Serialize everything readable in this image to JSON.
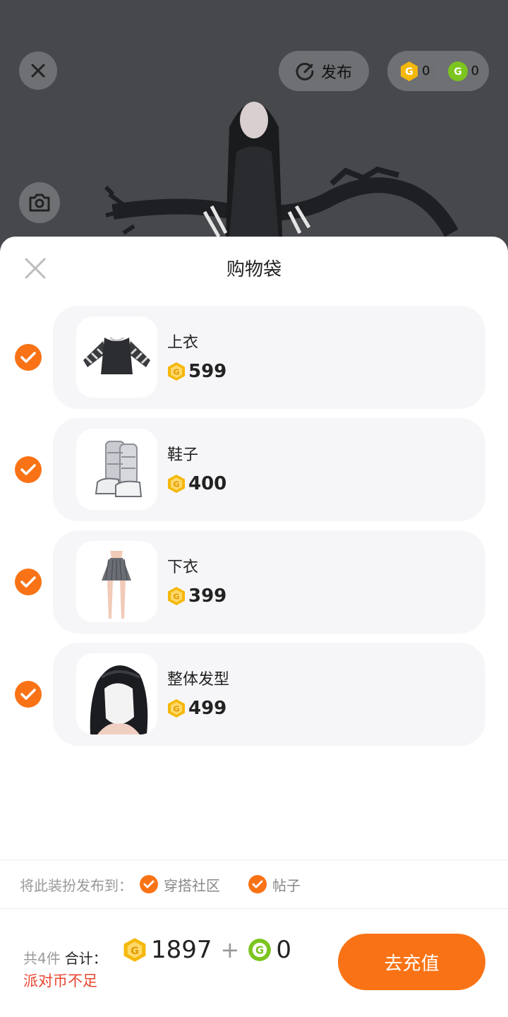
{
  "top_bar": {
    "publish_label": "发布",
    "gold_balance": "0",
    "green_balance": "0"
  },
  "sheet": {
    "title": "购物袋",
    "items": [
      {
        "name": "上衣",
        "price": "599",
        "checked": true
      },
      {
        "name": "鞋子",
        "price": "400",
        "checked": true
      },
      {
        "name": "下衣",
        "price": "399",
        "checked": true
      },
      {
        "name": "整体发型",
        "price": "499",
        "checked": true
      }
    ],
    "publish_to": {
      "label": "将此装扮发布到：",
      "options": [
        "穿搭社区",
        "帖子"
      ]
    }
  },
  "footer": {
    "count": "共4件",
    "total_label": "合计：",
    "gold_total": "1897",
    "plus": "+",
    "green_total": "0",
    "warning": "派对币不足",
    "recharge_label": "去充值"
  },
  "colors": {
    "accent": "#f97316",
    "warning": "#e8452f",
    "coin_gold": "#f5b80a",
    "coin_green": "#7cc41f"
  }
}
